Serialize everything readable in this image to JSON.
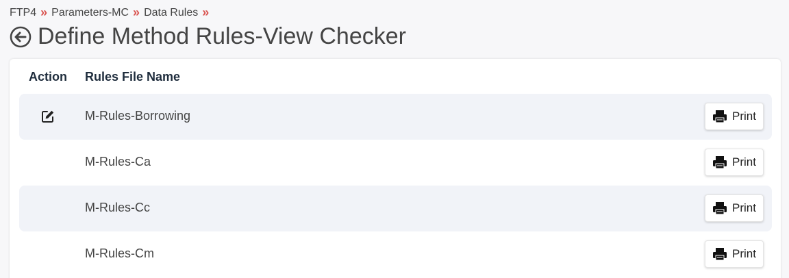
{
  "breadcrumb": [
    {
      "label": "FTP4"
    },
    {
      "label": "Parameters-MC"
    },
    {
      "label": "Data Rules"
    }
  ],
  "breadcrumb_separator": "»",
  "page_title": "Define Method Rules-View Checker",
  "table": {
    "headers": {
      "action": "Action",
      "name": "Rules File Name"
    },
    "rows": [
      {
        "name": "M-Rules-Borrowing",
        "print_label": "Print",
        "has_edit": true
      },
      {
        "name": "M-Rules-Ca",
        "print_label": "Print",
        "has_edit": false
      },
      {
        "name": "M-Rules-Cc",
        "print_label": "Print",
        "has_edit": false
      },
      {
        "name": "M-Rules-Cm",
        "print_label": "Print",
        "has_edit": false
      }
    ]
  },
  "colors": {
    "separator": "#d9534f",
    "stripe": "#f1f3f8",
    "header_text": "#1f2d3d"
  }
}
